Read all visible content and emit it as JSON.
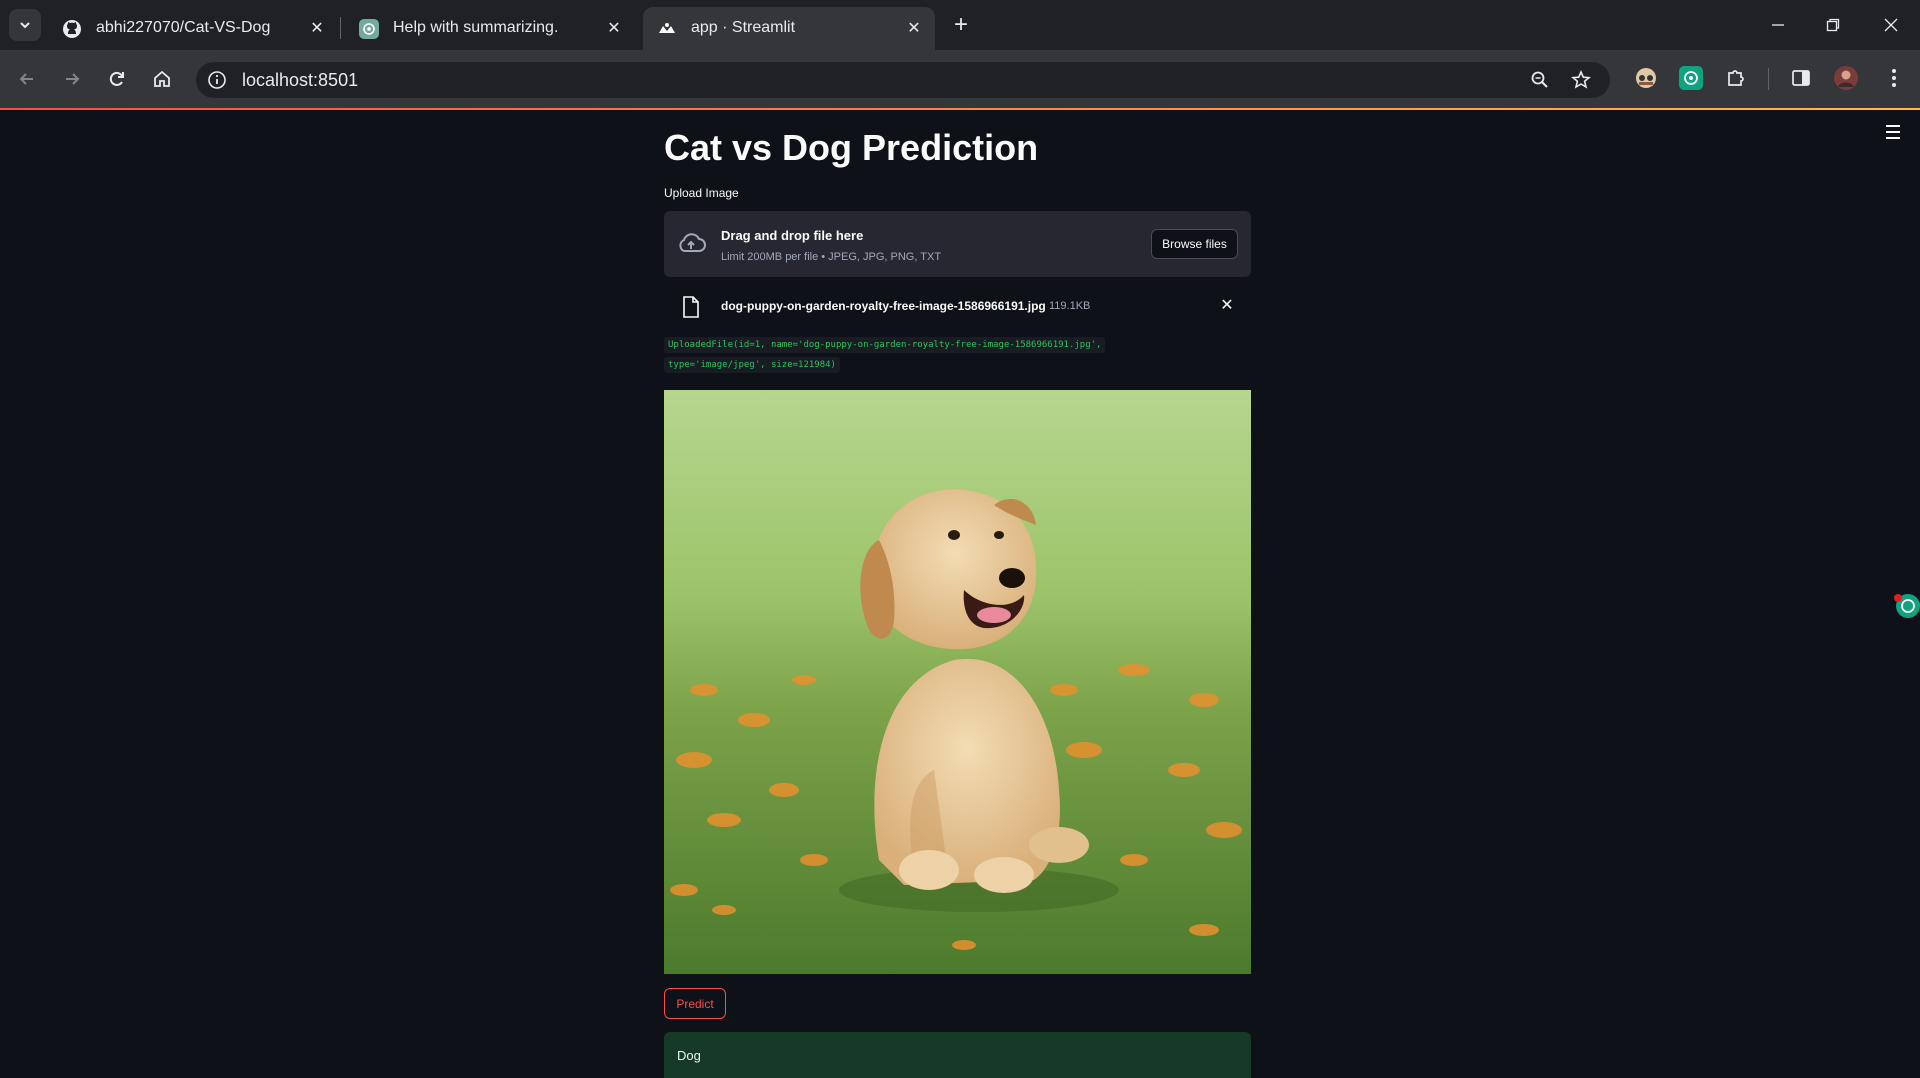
{
  "browser": {
    "tabs": [
      {
        "title": "abhi227070/Cat-VS-Dog",
        "icon": "github-icon",
        "active": false
      },
      {
        "title": "Help with summarizing.",
        "icon": "chatgpt-icon",
        "active": false
      },
      {
        "title": "app · Streamlit",
        "icon": "streamlit-icon",
        "active": true
      }
    ],
    "url": "localhost:8501"
  },
  "app": {
    "title": "Cat vs Dog Prediction",
    "uploader": {
      "label": "Upload Image",
      "drag_text": "Drag and drop file here",
      "limit_text": "Limit 200MB per file • JPEG, JPG, PNG, TXT",
      "browse_label": "Browse files"
    },
    "file": {
      "name": "dog-puppy-on-garden-royalty-free-image-1586966191.jpg",
      "size": "119.1KB"
    },
    "uploaded_repr": {
      "line1": "UploadedFile(id=1, name='dog-puppy-on-garden-royalty-free-image-1586966191.jpg',",
      "line2": "type='image/jpeg', size=121984)"
    },
    "image_subject": "golden retriever puppy sitting on grass with orange flowers",
    "predict_label": "Predict",
    "result": "Dog"
  },
  "colors": {
    "background": "#0e1117",
    "accent": "#ff4b4b",
    "success_bg": "#173928",
    "code_text": "#22c55e"
  }
}
